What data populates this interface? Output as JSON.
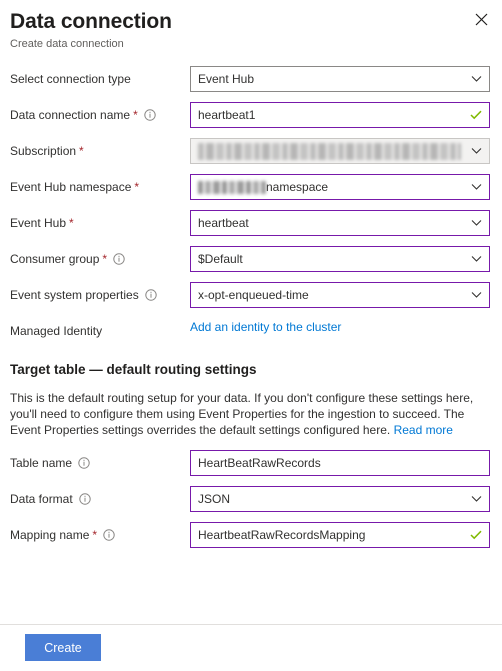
{
  "header": {
    "title": "Data connection",
    "subtitle": "Create data connection",
    "close_icon": "close-icon"
  },
  "form": {
    "rows": [
      {
        "label": "Select connection type",
        "required": false,
        "info": false,
        "type": "select",
        "value": "Event Hub",
        "style": "plain"
      },
      {
        "label": "Data connection name",
        "required": true,
        "info": true,
        "type": "text",
        "value": "heartbeat1",
        "style": "valid"
      },
      {
        "label": "Subscription",
        "required": true,
        "info": false,
        "type": "select",
        "value": "",
        "style": "disabled",
        "redacted": true
      },
      {
        "label": "Event Hub namespace",
        "required": true,
        "info": false,
        "type": "select",
        "value": "namespace",
        "style": "normal",
        "redacted_prefix": true
      },
      {
        "label": "Event Hub",
        "required": true,
        "info": false,
        "type": "select",
        "value": "heartbeat",
        "style": "normal"
      },
      {
        "label": "Consumer group",
        "required": true,
        "info": true,
        "type": "select",
        "value": "$Default",
        "style": "normal"
      },
      {
        "label": "Event system properties",
        "required": false,
        "info": true,
        "type": "select",
        "value": "x-opt-enqueued-time",
        "style": "normal"
      },
      {
        "label": "Managed Identity",
        "required": false,
        "info": false,
        "type": "link",
        "value": "Add an identity to the cluster",
        "style": "link"
      }
    ]
  },
  "section": {
    "title": "Target table — default routing settings",
    "description": "This is the default routing setup for your data. If you don't configure these settings here, you'll need to configure them using Event Properties for the ingestion to succeed. The Event Properties settings overrides the default settings configured here.",
    "read_more": "Read more",
    "rows": [
      {
        "label": "Table name",
        "required": false,
        "info": true,
        "type": "text",
        "value": "HeartBeatRawRecords",
        "style": "normal"
      },
      {
        "label": "Data format",
        "required": false,
        "info": true,
        "type": "select",
        "value": "JSON",
        "style": "normal"
      },
      {
        "label": "Mapping name",
        "required": true,
        "info": true,
        "type": "text",
        "value": "HeartbeatRawRecordsMapping",
        "style": "valid"
      }
    ]
  },
  "footer": {
    "create_label": "Create"
  },
  "colors": {
    "accent_button": "#4a7ed6",
    "field_border": "#7719aa",
    "link": "#0078d4",
    "required_asterisk": "#a4262c",
    "valid_check": "#7fba00"
  }
}
